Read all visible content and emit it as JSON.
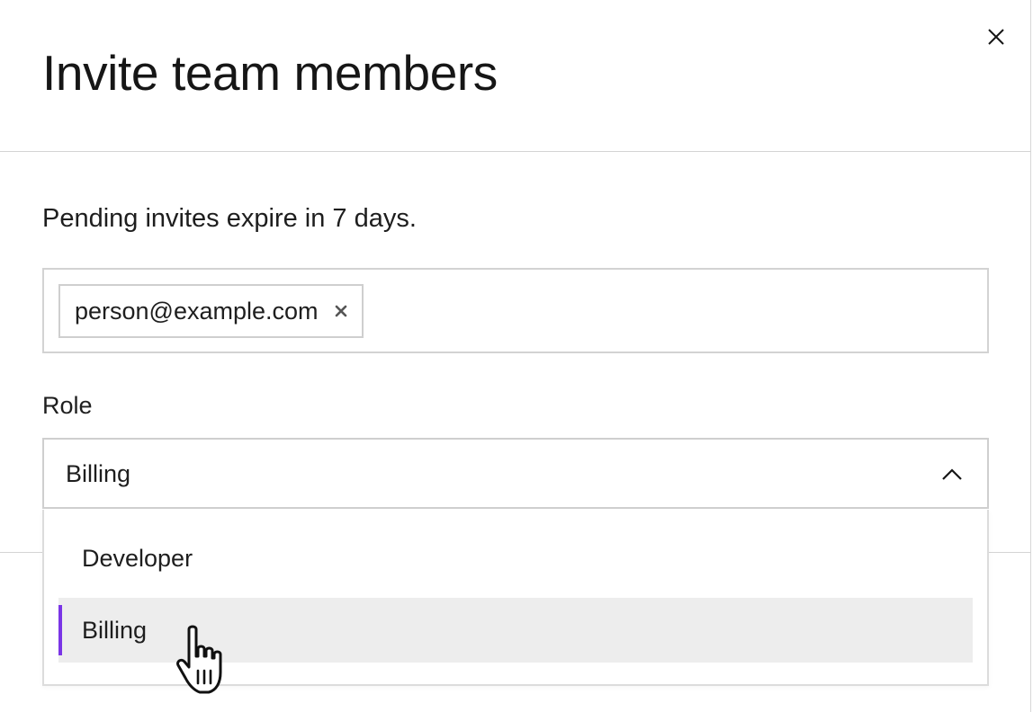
{
  "modal": {
    "title": "Invite team members",
    "close_icon": "close-icon"
  },
  "body": {
    "description": "Pending invites expire in 7 days.",
    "emails": [
      {
        "value": "person@example.com",
        "remove_icon": "remove-icon"
      }
    ]
  },
  "role": {
    "label": "Role",
    "selected_value": "Billing",
    "expanded": true,
    "chevron_icon": "chevron-up-icon",
    "options": [
      {
        "label": "Developer",
        "selected": false
      },
      {
        "label": "Billing",
        "selected": true
      }
    ]
  },
  "colors": {
    "accent": "#7a35e6",
    "selected_option_bg": "#ededed",
    "border": "#d3d3d3",
    "text": "#1e1e1e"
  },
  "pointer": {
    "icon": "hand-pointer-icon"
  }
}
